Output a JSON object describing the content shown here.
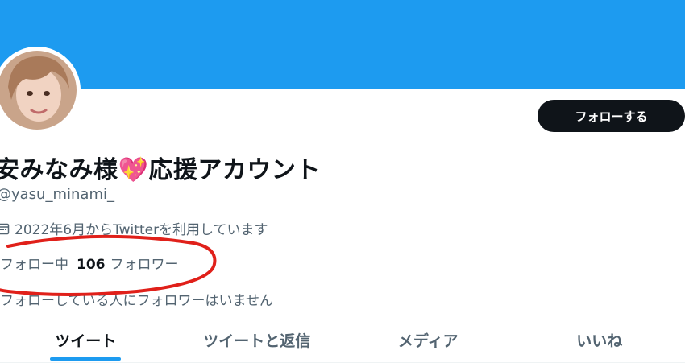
{
  "colors": {
    "banner": "#1d9bf0",
    "accent": "#1d9bf0",
    "follow_button": "#0f1419",
    "annotation": "#e0201a"
  },
  "profile": {
    "display_name": "安みなみ様💖応援アカウント",
    "handle": "@yasu_minami_",
    "joined_icon": "calendar-icon",
    "joined_text": "2022年6月からTwitterを利用しています",
    "following_label": "フォロー中",
    "followers_count": "106",
    "followers_label": "フォロワー",
    "followers_note": "フォローしている人にフォロワーはいません"
  },
  "actions": {
    "follow_label": "フォローする"
  },
  "tabs": [
    {
      "label": "ツイート",
      "active": true
    },
    {
      "label": "ツイートと返信",
      "active": false
    },
    {
      "label": "メディア",
      "active": false
    },
    {
      "label": "いいね",
      "active": false
    }
  ]
}
